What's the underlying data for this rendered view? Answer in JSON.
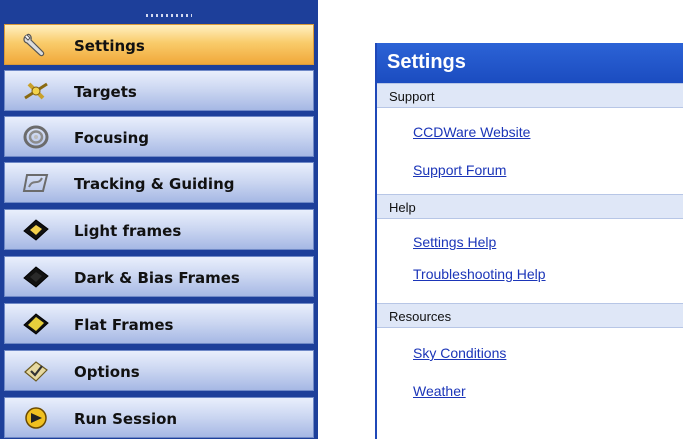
{
  "nav": {
    "items": [
      {
        "label": "Settings",
        "icon": "wrench-icon",
        "selected": true
      },
      {
        "label": "Targets",
        "icon": "target-satellite-icon",
        "selected": false
      },
      {
        "label": "Focusing",
        "icon": "focus-rings-icon",
        "selected": false
      },
      {
        "label": "Tracking & Guiding",
        "icon": "tracking-icon",
        "selected": false
      },
      {
        "label": "Light frames",
        "icon": "light-frame-icon",
        "selected": false
      },
      {
        "label": "Dark & Bias Frames",
        "icon": "dark-frame-icon",
        "selected": false
      },
      {
        "label": "Flat Frames",
        "icon": "flat-frame-icon",
        "selected": false
      },
      {
        "label": "Options",
        "icon": "options-check-icon",
        "selected": false
      },
      {
        "label": "Run Session",
        "icon": "run-session-icon",
        "selected": false
      }
    ]
  },
  "pane": {
    "title": "Settings",
    "sections": [
      {
        "title": "Support",
        "links": [
          "CCDWare Website",
          "Support Forum"
        ]
      },
      {
        "title": "Help",
        "links": [
          "Settings Help",
          "Troubleshooting Help"
        ]
      },
      {
        "title": "Resources",
        "links": [
          "Sky Conditions",
          "Weather"
        ]
      }
    ]
  },
  "colors": {
    "nav_background": "#1d3f9a",
    "selected_item": "#f9cc6b",
    "item_background": "#cdd8f2",
    "pane_header": "#1b4cc0",
    "section_header": "#dfe7f7",
    "link": "#1b35b8"
  }
}
